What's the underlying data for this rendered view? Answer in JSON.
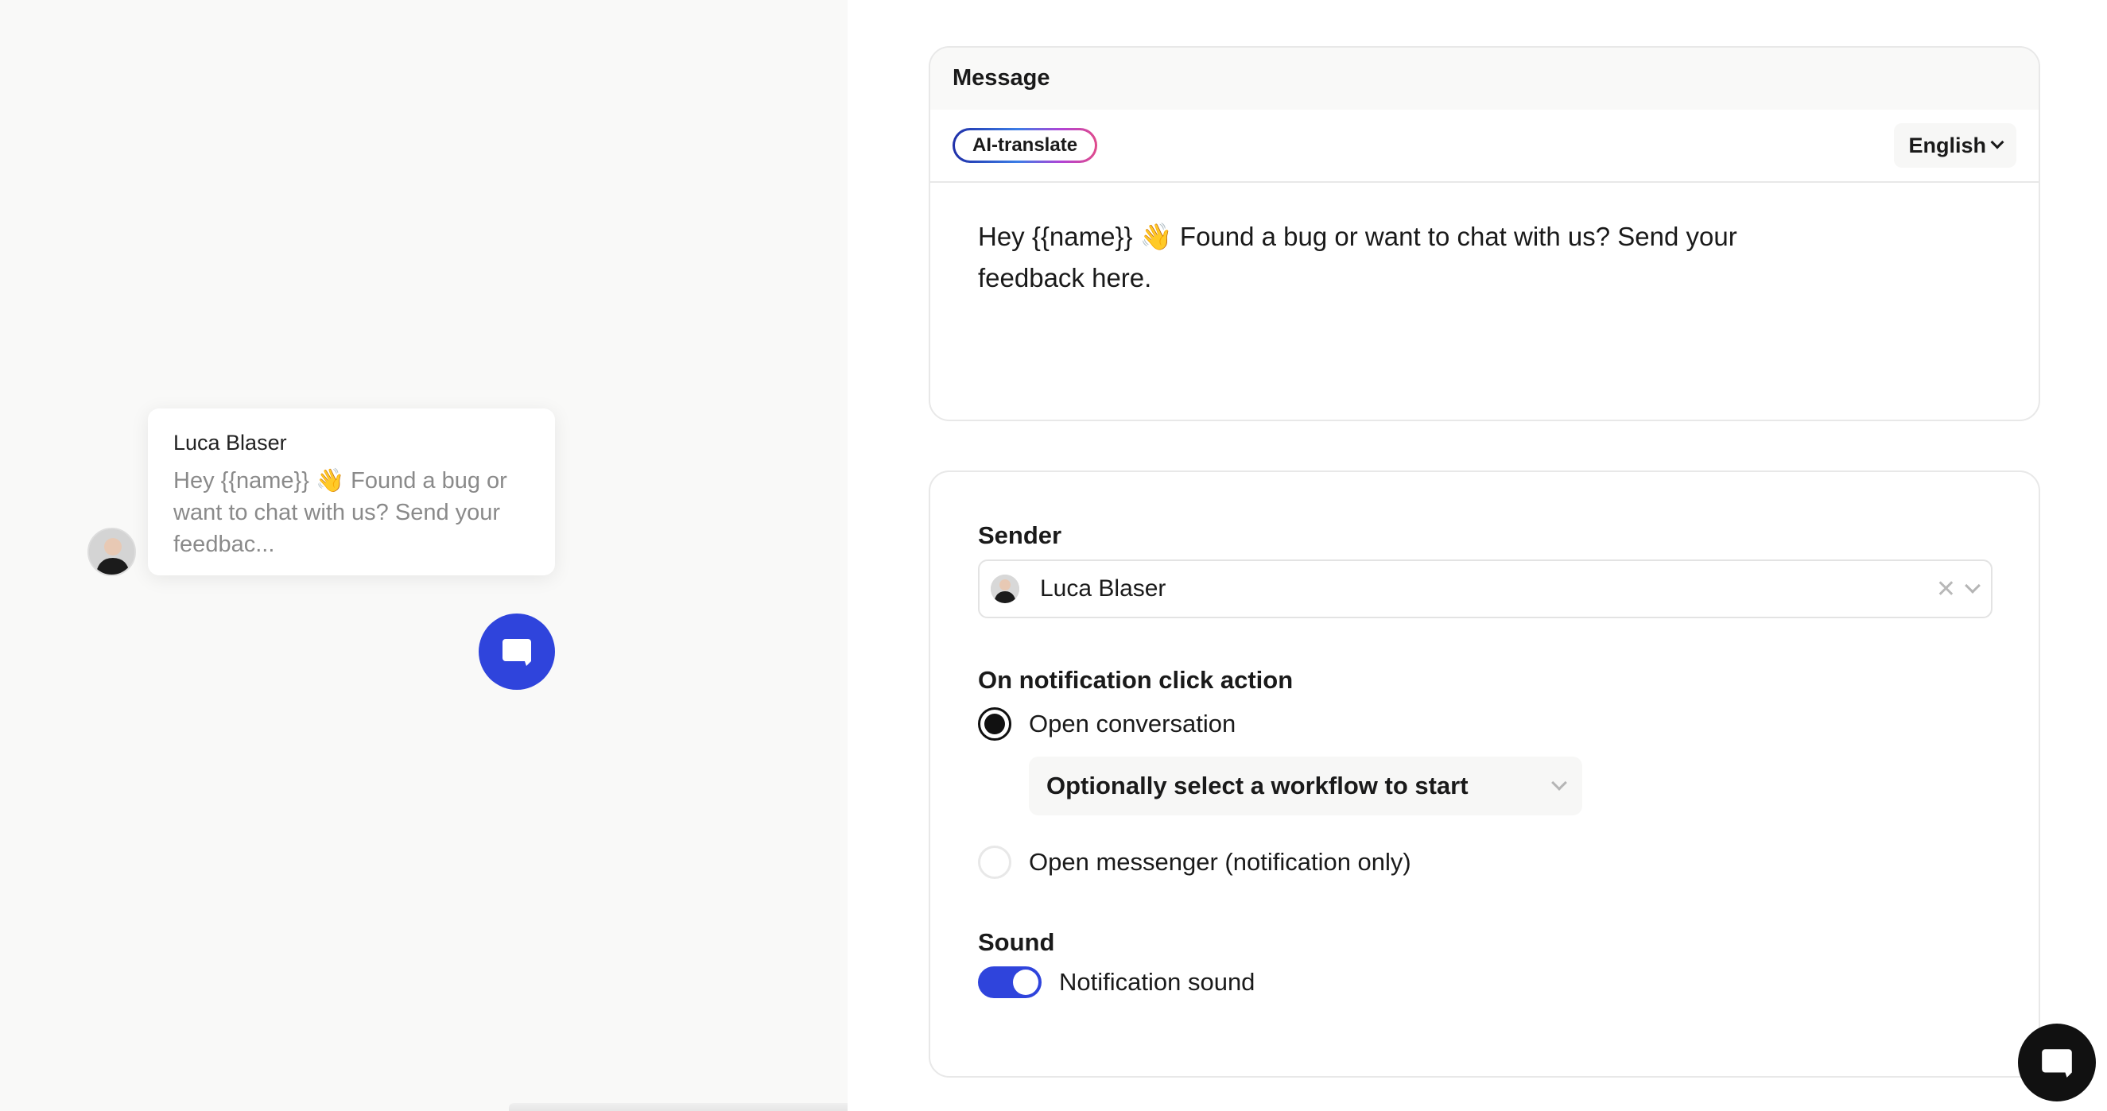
{
  "preview": {
    "sender_name": "Luca Blaser",
    "message": "Hey {{name}} 👋 Found a bug or want to chat with us? Send your feedbac..."
  },
  "message_section": {
    "title": "Message",
    "ai_translate_label": "AI-translate",
    "language": "English",
    "body": "Hey {{name}} 👋 Found a bug or want to chat with us? Send your feedback here."
  },
  "settings": {
    "sender_label": "Sender",
    "sender_value": "Luca Blaser",
    "click_action_label": "On notification click action",
    "option_open_conversation": "Open conversation",
    "workflow_placeholder": "Optionally select a workflow to start",
    "option_open_messenger": "Open messenger (notification only)",
    "sound_label": "Sound",
    "notification_sound_label": "Notification sound",
    "notification_sound_on": true,
    "selected_option": "Open conversation"
  },
  "colors": {
    "accent": "#2f44dc",
    "launcher_dark": "#111111"
  },
  "icons": {
    "chat": "chat-bubble-icon",
    "chevron": "chevron-down-icon",
    "clear": "close-icon"
  }
}
